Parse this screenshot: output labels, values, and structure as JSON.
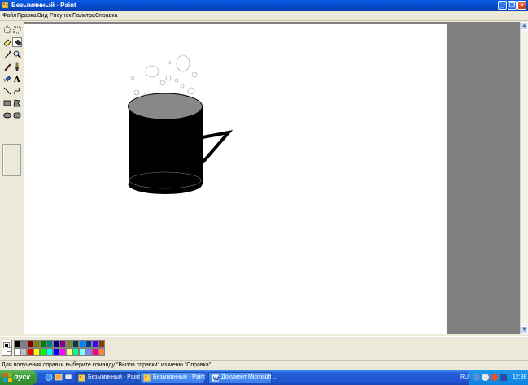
{
  "window": {
    "title": "Безымянный - Paint",
    "controls": [
      "minimize",
      "maximize",
      "close"
    ]
  },
  "menu": {
    "items": [
      "Файл",
      "Правка",
      "Вид",
      "Рисунок",
      "Палитра",
      "Справка"
    ]
  },
  "toolbox": {
    "tools": [
      {
        "name": "free-select-icon"
      },
      {
        "name": "rect-select-icon"
      },
      {
        "name": "eraser-icon"
      },
      {
        "name": "fill-icon",
        "selected": true
      },
      {
        "name": "color-picker-icon"
      },
      {
        "name": "magnifier-icon"
      },
      {
        "name": "pencil-icon"
      },
      {
        "name": "brush-icon"
      },
      {
        "name": "airbrush-icon"
      },
      {
        "name": "text-icon",
        "glyph": "A"
      },
      {
        "name": "line-icon"
      },
      {
        "name": "curve-icon"
      },
      {
        "name": "rectangle-icon"
      },
      {
        "name": "polygon-icon"
      },
      {
        "name": "ellipse-icon"
      },
      {
        "name": "rounded-rect-icon"
      }
    ]
  },
  "palette": {
    "foreground": "#000000",
    "background": "#ffffff",
    "row1": [
      "#000000",
      "#808080",
      "#800000",
      "#808000",
      "#008000",
      "#008080",
      "#000080",
      "#800080",
      "#808040",
      "#004040",
      "#0080ff",
      "#004080",
      "#4000ff",
      "#804000"
    ],
    "row2": [
      "#ffffff",
      "#c0c0c0",
      "#ff0000",
      "#ffff00",
      "#00ff00",
      "#00ffff",
      "#0000ff",
      "#ff00ff",
      "#ffff80",
      "#00ff80",
      "#80ffff",
      "#8080ff",
      "#ff0080",
      "#ff8040"
    ]
  },
  "status": {
    "text": "Для получения справки выберите команду \"Вызов справки\" из меню \"Справка\"."
  },
  "taskbar": {
    "start_label": "пуск",
    "tasks": [
      {
        "label": "Безымянный - Paint",
        "icon": "paint-icon",
        "active": true
      },
      {
        "label": "Безымянный - Paint",
        "icon": "paint-icon",
        "active": false
      },
      {
        "label": "Документ Microsoft ...",
        "icon": "word-icon",
        "active": false
      }
    ],
    "language": "RU",
    "clock": "12:38"
  }
}
